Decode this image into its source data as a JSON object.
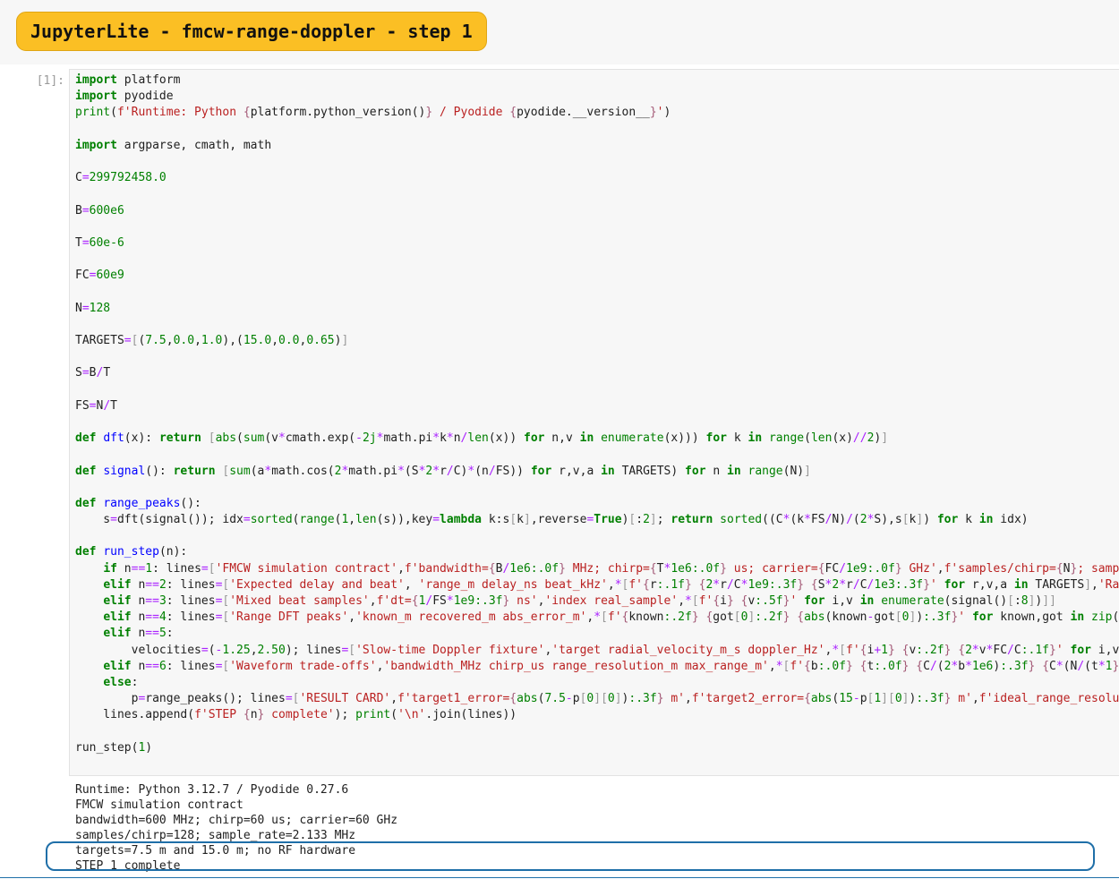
{
  "window": {
    "title": "JupyterLite - fmcw-range-doppler - step 1"
  },
  "cell": {
    "prompt": "[1]:",
    "source_lines": [
      "import platform",
      "import pyodide",
      "print(f'Runtime: Python {platform.python_version()} / Pyodide {pyodide.__version__}')",
      "",
      "import argparse, cmath, math",
      "",
      "C=299792458.0",
      "",
      "B=600e6",
      "",
      "T=60e-6",
      "",
      "FC=60e9",
      "",
      "N=128",
      "",
      "TARGETS=[(7.5,0.0,1.0),(15.0,0.0,0.65)]",
      "",
      "S=B/T",
      "",
      "FS=N/T",
      "",
      "def dft(x): return [abs(sum(v*cmath.exp(-2j*math.pi*k*n/len(x)) for n,v in enumerate(x))) for k in range(len(x)//2)]",
      "",
      "def signal(): return [sum(a*math.cos(2*math.pi*(S*2*r/C)*(n/FS)) for r,v,a in TARGETS) for n in range(N)]",
      "",
      "def range_peaks():",
      "    s=dft(signal()); idx=sorted(range(1,len(s)),key=lambda k:s[k],reverse=True)[:2]; return sorted((C*(k*FS/N)/(2*S),s[k]) for k in idx)",
      "",
      "def run_step(n):",
      "    if n==1: lines=['FMCW simulation contract',f'bandwidth={B/1e6:.0f} MHz; chirp={T*1e6:.0f} us; carrier={FC/1e9:.0f} GHz',f'samples/chirp={N}; samp",
      "    elif n==2: lines=['Expected delay and beat', 'range_m delay_ns beat_kHz',*[f'{r:.1f} {2*r/C*1e9:.3f} {S*2*r/C/1e3:.3f}' for r,v,a in TARGETS],'Ra",
      "    elif n==3: lines=['Mixed beat samples',f'dt={1/FS*1e9:.3f} ns','index real_sample',*[f'{i} {v:.5f}' for i,v in enumerate(signal()[:8])]]",
      "    elif n==4: lines=['Range DFT peaks','known_m recovered_m abs_error_m',*[f'{known:.2f} {got[0]:.2f} {abs(known-got[0]):.3f}' for known,got in zip(",
      "    elif n==5:",
      "        velocities=(-1.25,2.50); lines=['Slow-time Doppler fixture','target radial_velocity_m_s doppler_Hz',*[f'{i+1} {v:.2f} {2*v*FC/C:.1f}' for i,v",
      "    elif n==6: lines=['Waveform trade-offs','bandwidth_MHz chirp_us range_resolution_m max_range_m',*[f'{b:.0f} {t:.0f} {C/(2*b*1e6):.3f} {C*(N/(t*1e",
      "    else:",
      "        p=range_peaks(); lines=['RESULT CARD',f'target1_error={abs(7.5-p[0][0]):.3f} m',f'target2_error={abs(15-p[1][0]):.3f} m',f'ideal_range_resolu",
      "    lines.append(f'STEP {n} complete'); print('\\n'.join(lines))",
      "",
      "run_step(1)"
    ]
  },
  "output": {
    "lines": [
      "Runtime: Python 3.12.7 / Pyodide 0.27.6",
      "FMCW simulation contract",
      "bandwidth=600 MHz; chirp=60 us; carrier=60 GHz",
      "samples/chirp=128; sample_rate=2.133 MHz",
      "targets=7.5 m and 15.0 m; no RF hardware",
      "STEP 1 complete"
    ]
  },
  "colors": {
    "title_pill": "#fbbf24",
    "highlight_border": "#1f6fa8",
    "keyword": "#008000",
    "string": "#ba2121",
    "operator": "#aa22ff",
    "function": "#0000ff"
  }
}
